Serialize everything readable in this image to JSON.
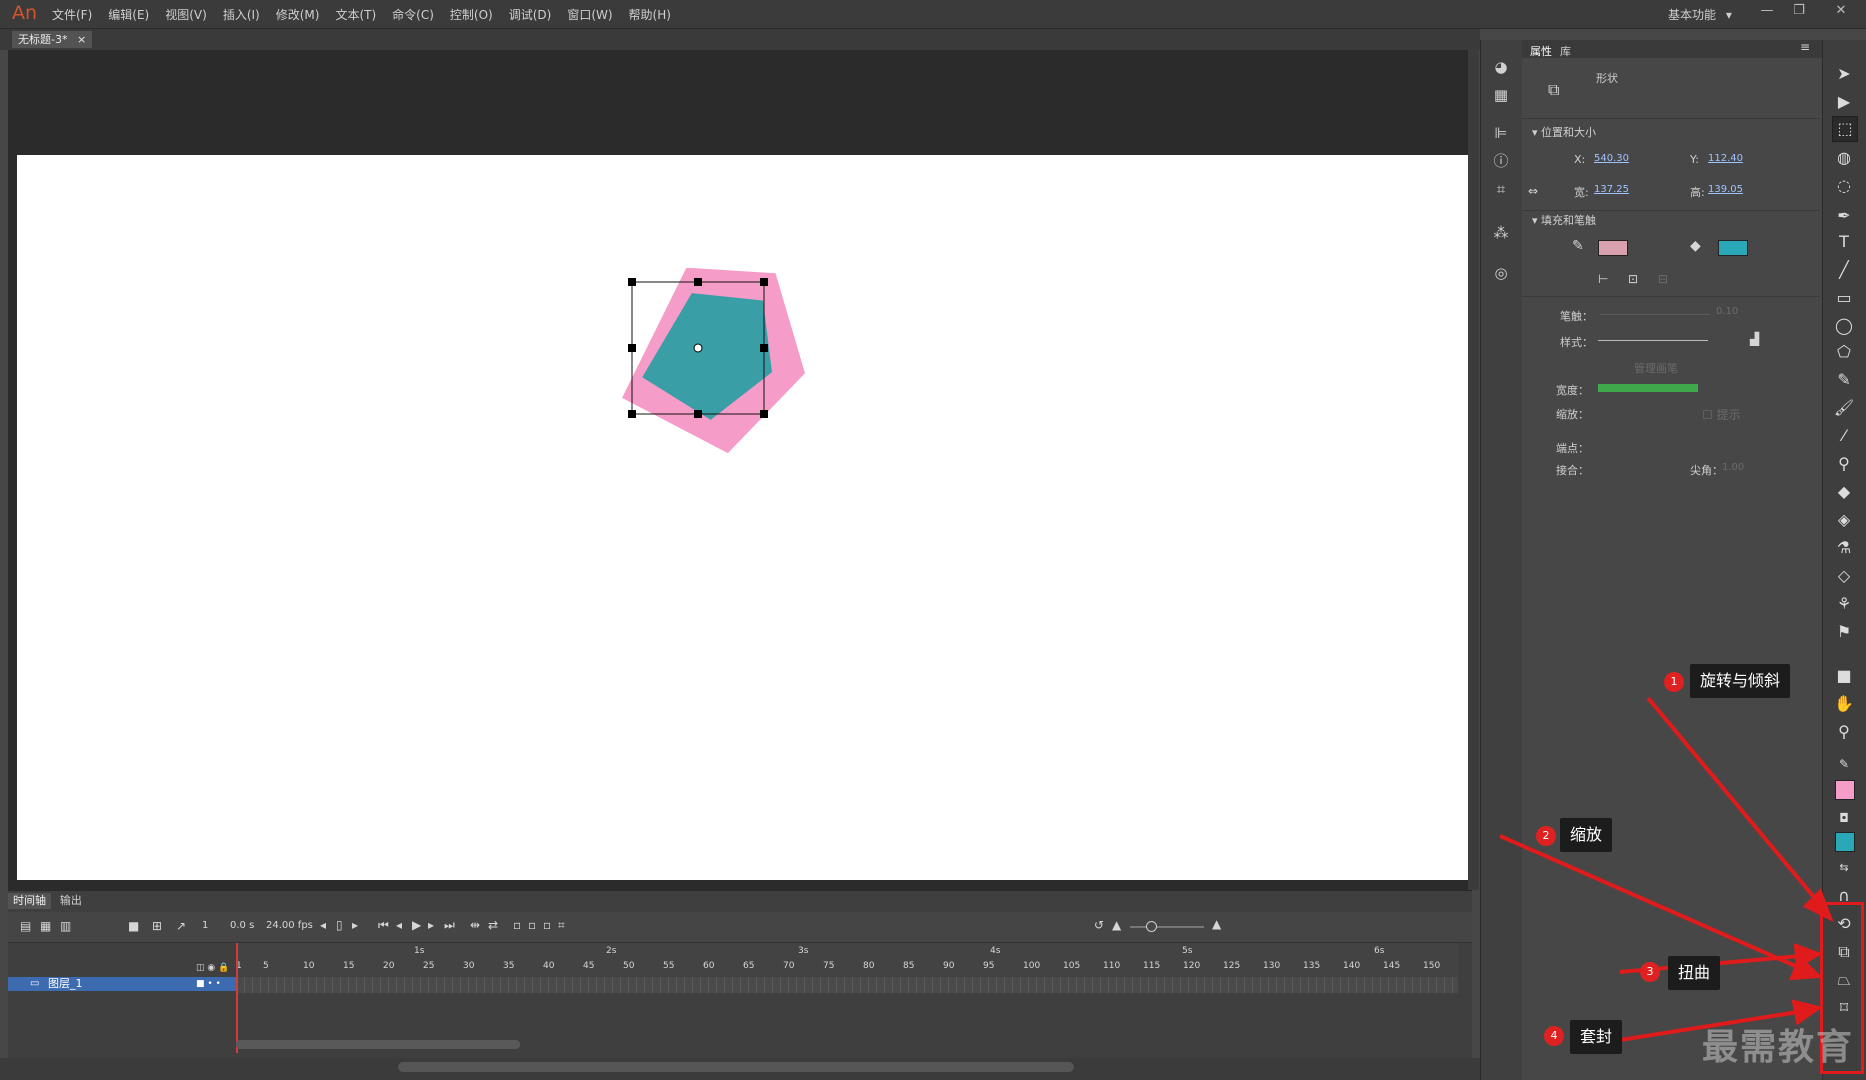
{
  "app": {
    "logo": "An",
    "menus": [
      "文件(F)",
      "编辑(E)",
      "视图(V)",
      "插入(I)",
      "修改(M)",
      "文本(T)",
      "命令(C)",
      "控制(O)",
      "调试(D)",
      "窗口(W)",
      "帮助(H)"
    ],
    "workspace": "基本功能",
    "workspace_arrow": "▾",
    "win_min": "—",
    "win_restore": "❐",
    "win_close": "✕"
  },
  "document": {
    "tab_title": "无标题-3*",
    "tab_close": "×"
  },
  "timeline": {
    "tabs": [
      "时间轴",
      "输出"
    ],
    "frame_number": "1",
    "time": "0.0 s",
    "fps": "24.00 fps",
    "seconds": [
      "1s",
      "2s",
      "3s",
      "4s",
      "5s",
      "6s"
    ],
    "frames": [
      "1",
      "5",
      "10",
      "15",
      "20",
      "25",
      "30",
      "35",
      "40",
      "45",
      "50",
      "55",
      "60",
      "65",
      "70",
      "75",
      "80",
      "85",
      "90",
      "95",
      "100",
      "105",
      "110",
      "115",
      "120",
      "125",
      "130",
      "135",
      "140",
      "145",
      "150"
    ],
    "layer_name": "图层_1"
  },
  "properties": {
    "tab_properties": "属性",
    "tab_library": "库",
    "object_type": "形状",
    "section_position": "位置和大小",
    "x_label": "X:",
    "x_value": "540.30",
    "y_label": "Y:",
    "y_value": "112.40",
    "w_label": "宽:",
    "w_value": "137.25",
    "h_label": "高:",
    "h_value": "139.05",
    "section_fill": "填充和笔触",
    "stroke_label": "笔触：",
    "stroke_value": "0.10",
    "style_label": "样式：",
    "manage_brushes": "管理画笔",
    "width_label": "宽度：",
    "scale_label": "缩放：",
    "hint_label": "提示",
    "cap_label": "端点：",
    "join_label": "接合：",
    "miter_label": "尖角：",
    "miter_value": "1.00",
    "fill_color": "#2aa8b8",
    "stroke_color": "#e07b9c"
  },
  "callouts": [
    {
      "num": "1",
      "text": "旋转与倾斜"
    },
    {
      "num": "2",
      "text": "缩放"
    },
    {
      "num": "3",
      "text": "扭曲"
    },
    {
      "num": "4",
      "text": "套封"
    }
  ],
  "watermark": "最需教育",
  "colors": {
    "shape_fill": "#3a9ea6",
    "shape_border": "#f59cc8",
    "tool_fill_swatch": "#f59cc8",
    "tool_stroke_swatch": "#2aa8b8",
    "highlight": "#e01b1b"
  }
}
